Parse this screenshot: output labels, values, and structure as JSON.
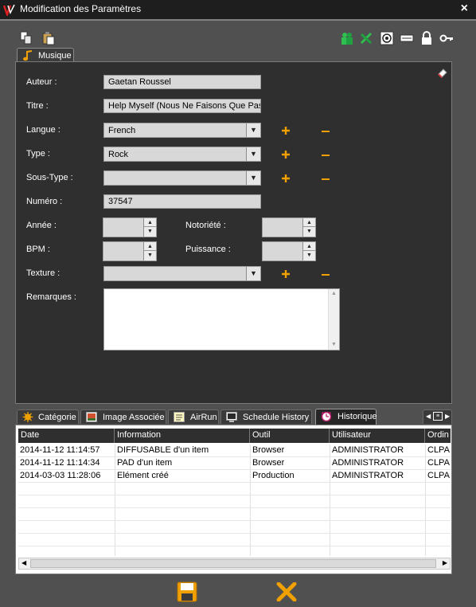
{
  "window": {
    "title": "Modification des Paramètres"
  },
  "toolbar": {
    "left_icons": [
      "copy-icon",
      "paste-icon"
    ],
    "right_icons": [
      "users-icon",
      "tools-icon",
      "target-icon",
      "keyboard-icon",
      "lock-icon",
      "key-icon"
    ]
  },
  "top_tab": {
    "label": "Musique",
    "icon": "music-note-icon"
  },
  "form": {
    "auteur_label": "Auteur :",
    "auteur_value": "Gaetan Roussel",
    "titre_label": "Titre :",
    "titre_value": "Help Myself (Nous Ne Faisons Que Pas",
    "langue_label": "Langue :",
    "langue_value": "French",
    "type_label": "Type :",
    "type_value": "Rock",
    "soustype_label": "Sous-Type :",
    "soustype_value": "",
    "numero_label": "Numéro :",
    "numero_value": "37547",
    "annee_label": "Année :",
    "notoriete_label": "Notoriété :",
    "bpm_label": "BPM :",
    "puissance_label": "Puissance :",
    "texture_label": "Texture :",
    "texture_value": "",
    "remarques_label": "Remarques :"
  },
  "bottom_tabs": [
    {
      "label": "Catégorie",
      "icon": "category-icon"
    },
    {
      "label": "Image Associée",
      "icon": "image-icon"
    },
    {
      "label": "AirRun",
      "icon": "airrun-icon"
    },
    {
      "label": "Schedule History",
      "icon": "schedule-icon"
    },
    {
      "label": "Historique",
      "icon": "history-icon",
      "active": true
    }
  ],
  "history_table": {
    "columns": [
      "Date",
      "Information",
      "Outil",
      "Utilisateur",
      "Ordin"
    ],
    "rows": [
      [
        "2014-11-12 11:14:57",
        "DIFFUSABLE d'un item",
        "Browser",
        "ADMINISTRATOR",
        "CLPA"
      ],
      [
        "2014-11-12 11:14:34",
        "PAD d'un item",
        "Browser",
        "ADMINISTRATOR",
        "CLPA"
      ],
      [
        "2014-03-03 11:28:06",
        "Elément créé",
        "Production",
        "ADMINISTRATOR",
        "CLPA"
      ]
    ]
  },
  "footer": {
    "save_icon": "save-icon",
    "cancel_icon": "cancel-icon"
  },
  "colors": {
    "accent": "#f0a000",
    "panel": "#2f2f2f",
    "window": "#505050"
  }
}
